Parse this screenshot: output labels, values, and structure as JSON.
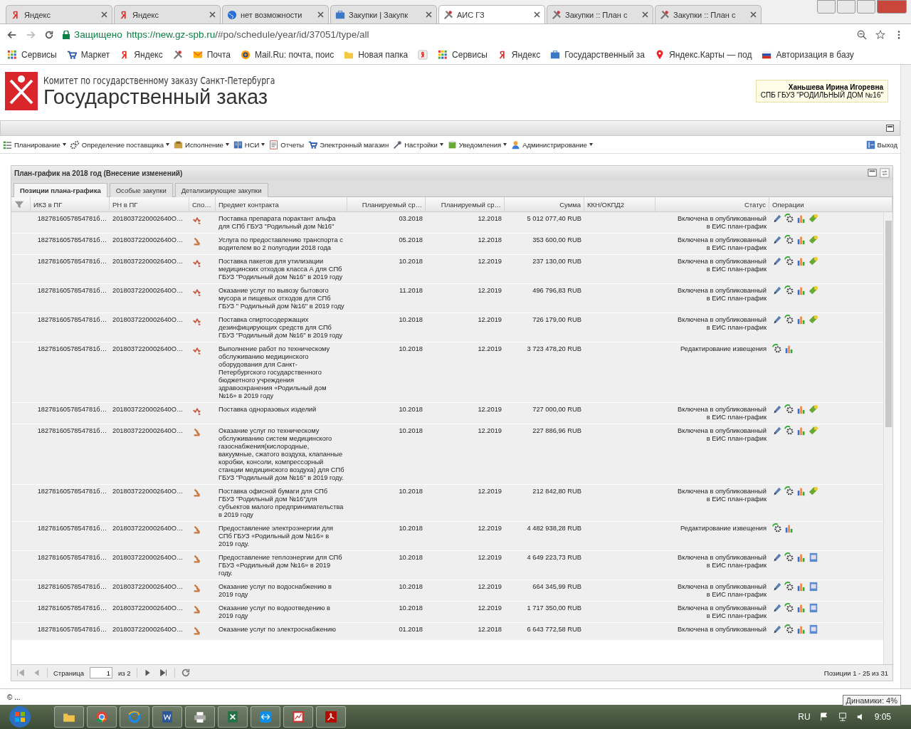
{
  "browser": {
    "tabs": [
      {
        "title": "Яндекс",
        "kind": "yandex",
        "selected": false
      },
      {
        "title": "Яндекс",
        "kind": "yandex",
        "selected": false
      },
      {
        "title": "нет возможности",
        "kind": "globe",
        "selected": false
      },
      {
        "title": "Закупки | Закупк",
        "kind": "case",
        "selected": false
      },
      {
        "title": "АИС ГЗ",
        "kind": "tools",
        "selected": true
      },
      {
        "title": "Закупки :: План с",
        "kind": "tools",
        "selected": false
      },
      {
        "title": "Закупки :: План с",
        "kind": "tools",
        "selected": false
      }
    ],
    "secure_label": "Защищено",
    "url_host": "https://new.gz-spb.ru",
    "url_path": "/#po/schedule/year/id/37051/type/all",
    "bookmarks": [
      {
        "label": "Сервисы",
        "kind": "apps"
      },
      {
        "label": "Маркет",
        "kind": "cart"
      },
      {
        "label": "Яндекс",
        "kind": "yandex"
      },
      {
        "kind": "tools"
      },
      {
        "label": "Почта",
        "kind": "mail"
      },
      {
        "label": "Mail.Ru: почта, поис",
        "kind": "at"
      },
      {
        "label": "Новая папка",
        "kind": "folder"
      },
      {
        "kind": "ya-box"
      },
      {
        "label": "Сервисы",
        "kind": "apps"
      },
      {
        "label": "Яндекс",
        "kind": "yandex"
      },
      {
        "label": "Государственный за",
        "kind": "case"
      },
      {
        "label": "Яндекс.Карты — под",
        "kind": "pin"
      },
      {
        "label": "Авторизация в базу",
        "kind": "flag"
      }
    ]
  },
  "header": {
    "org": "Комитет по государственному заказу Санкт-Петербурга",
    "title": "Государственный заказ",
    "user_name": "Ханьшева Ирина Игоревна",
    "user_org": "СПБ ГБУЗ \"РОДИЛЬНЫЙ ДОМ №16\""
  },
  "menu": [
    {
      "label": "Планирование",
      "kind": "list",
      "caret": true
    },
    {
      "label": "Определение поставщика",
      "kind": "gears",
      "caret": true
    },
    {
      "label": "Исполнение",
      "kind": "box",
      "caret": true
    },
    {
      "label": "НСИ",
      "kind": "book",
      "caret": true
    },
    {
      "label": "Отчеты",
      "kind": "report",
      "caret": false
    },
    {
      "label": "Электронный магазин",
      "kind": "cart",
      "caret": false
    },
    {
      "label": "Настройки",
      "kind": "wrench",
      "caret": true
    },
    {
      "label": "Уведомления",
      "kind": "note",
      "caret": true
    },
    {
      "label": "Администрирование",
      "kind": "person",
      "caret": true
    }
  ],
  "logout": "Выход",
  "panel": {
    "title": "План-график на 2018 год (Внесение изменений)",
    "tabs": [
      {
        "label": "Позиции плана-графика",
        "selected": true
      },
      {
        "label": "Особые закупки",
        "selected": false
      },
      {
        "label": "Детализирующие закупки",
        "selected": false
      }
    ],
    "columns": [
      "ИКЗ в ПГ",
      "РН в ПГ",
      "Спо…",
      "Предмет контракта",
      "Планируемый ср…",
      "Планируемый ср…",
      "Сумма",
      "ККН/ОКПД2",
      "Статус",
      "Операции"
    ],
    "rows": [
      {
        "ikz": "1827816057854781б…",
        "rn": "2018037220002640О…",
        "kind": "tender",
        "subject": "Поставка препарата порактант альфа для СПб ГБУЗ \"Родильный дом №16\"",
        "start": "03.2018",
        "end": "12.2018",
        "sum": "5 012 077,40 RUB",
        "status": "Включена в опубликованный\nв ЕИС план-график",
        "operations": {
          "kind": "full"
        }
      },
      {
        "ikz": "1827816057854781б…",
        "rn": "2018037220002640О…",
        "kind": "auction",
        "subject": "Услуга по предоставлению транспорта с водителем во 2 полугодии 2018 года",
        "start": "05.2018",
        "end": "12.2018",
        "sum": "353 600,00 RUB",
        "status": "Включена в опубликованный\nв ЕИС план-график",
        "operations": {
          "kind": "full"
        }
      },
      {
        "ikz": "1827816057854781б…",
        "rn": "2018037220002640О…",
        "kind": "tender",
        "subject": "Поставка пакетов для утилизации медицинских отходов класса А для СПб ГБУЗ \"Родильный дом №16\" в 2019 году",
        "start": "10.2018",
        "end": "12.2019",
        "sum": "237 130,00 RUB",
        "status": "Включена в опубликованный\nв ЕИС план-график",
        "operations": {
          "kind": "full"
        }
      },
      {
        "ikz": "1827816057854781б…",
        "rn": "2018037220002640О…",
        "kind": "tender",
        "subject": "Оказание услуг по вывозу бытового мусора и пищевых отходов для СПб ГБУЗ \" Родильный дом №16\" в 2019 году",
        "start": "11.2018",
        "end": "12.2019",
        "sum": "496 796,83 RUB",
        "status": "Включена в опубликованный\nв ЕИС план-график",
        "operations": {
          "kind": "full"
        }
      },
      {
        "ikz": "1827816057854781б…",
        "rn": "2018037220002640О…",
        "kind": "tender",
        "subject": "Поставка спиртосодержащих дезинфицирующих средств для СПб ГБУЗ \"Родильный дом №16\" в 2019 году",
        "start": "10.2018",
        "end": "12.2019",
        "sum": "726 179,00 RUB",
        "status": "Включена в опубликованный\nв ЕИС план-график",
        "operations": {
          "kind": "full"
        }
      },
      {
        "ikz": "1827816057854781б…",
        "rn": "2018037220002640О…",
        "kind": "tender",
        "subject": "Выполнение работ по техническому обслуживанию медицинского оборудования для Санкт-Петербургского государственного бюджетного учреждения здравоохранения «Родильный дом №16» в 2019 году",
        "start": "10.2018",
        "end": "12.2019",
        "sum": "3 723 478,20 RUB",
        "status": "Редактирование извещения",
        "operations": {
          "kind": "notice"
        }
      },
      {
        "ikz": "1827816057854781б…",
        "rn": "2018037220002640О…",
        "kind": "tender",
        "subject": "Поставка одноразовых изделий",
        "start": "10.2018",
        "end": "12.2019",
        "sum": "727 000,00 RUB",
        "status": "Включена в опубликованный\nв ЕИС план-график",
        "operations": {
          "kind": "full"
        }
      },
      {
        "ikz": "1827816057854781б…",
        "rn": "2018037220002640О…",
        "kind": "auction",
        "subject": "Оказание услуг по техническому обслуживанию систем медицинского газоснабжения(кислородные, вакуумные, сжатого воздуха, клапанные коробки, консоли, компрессорный станции медицинского воздуха) для СПб ГБУЗ \"Родильный дом №16\" в 2019 году.",
        "start": "10.2018",
        "end": "12.2019",
        "sum": "227 886,96 RUB",
        "status": "Включена в опубликованный\nв ЕИС план-график",
        "operations": {
          "kind": "full"
        }
      },
      {
        "ikz": "1827816057854781б…",
        "rn": "2018037220002640О…",
        "kind": "auction",
        "subject": "Поставка офисной бумаги для СПб ГБУЗ \"Родильный дом №16\"для субъектов малого предпринимательства в 2019 году",
        "start": "10.2018",
        "end": "12.2019",
        "sum": "212 842,80 RUB",
        "status": "Включена в опубликованный\nв ЕИС план-график",
        "operations": {
          "kind": "full"
        }
      },
      {
        "ikz": "1827816057854781б…",
        "rn": "2018037220002640О…",
        "kind": "auction",
        "subject": "Предоставление электроэнергии для СПб ГБУЗ «Родильный дом №16» в 2019 году.",
        "start": "10.2018",
        "end": "12.2019",
        "sum": "4 482 938,28 RUB",
        "status": "Редактирование извещения",
        "operations": {
          "kind": "notice"
        }
      },
      {
        "ikz": "1827816057854781б…",
        "rn": "2018037220002640О…",
        "kind": "auction",
        "subject": "Предоставление теплоэнергии для СПб ГБУЗ «Родильный дом №16» в 2019 году.",
        "start": "10.2018",
        "end": "12.2019",
        "sum": "4 649 223,73 RUB",
        "status": "Включена в опубликованный\nв ЕИС план-график",
        "operations": {
          "kind": "utility"
        }
      },
      {
        "ikz": "1827816057854781б…",
        "rn": "2018037220002640О…",
        "kind": "auction",
        "subject": "Оказание услуг по водоснабжению в 2019 году",
        "start": "10.2018",
        "end": "12.2019",
        "sum": "664 345,99 RUB",
        "status": "Включена в опубликованный\nв ЕИС план-график",
        "operations": {
          "kind": "utility"
        }
      },
      {
        "ikz": "1827816057854781б…",
        "rn": "2018037220002640О…",
        "kind": "auction",
        "subject": "Оказание услуг по водоотведению в 2019 году",
        "start": "10.2018",
        "end": "12.2019",
        "sum": "1 717 350,00 RUB",
        "status": "Включена в опубликованный\nв ЕИС план-график",
        "operations": {
          "kind": "utility"
        }
      },
      {
        "ikz": "1827816057854781б…",
        "rn": "2018037220002640О…",
        "kind": "auction",
        "subject": "Оказание услуг по электроснабжению",
        "start": "01.2018",
        "end": "12.2018",
        "sum": "6 643 772,58 RUB",
        "status": "Включена в опубликованный",
        "operations": {
          "kind": "utility"
        }
      }
    ],
    "pager": {
      "page_label": "Страница",
      "page": "1",
      "of": "из 2",
      "summary": "Позиции 1 - 25 из 31"
    }
  },
  "status_bar": "© ...",
  "taskbar": {
    "apps": [
      {
        "kind": "explorer"
      },
      {
        "kind": "chrome"
      },
      {
        "kind": "ie"
      },
      {
        "kind": "word"
      },
      {
        "kind": "printer"
      },
      {
        "kind": "excel"
      },
      {
        "kind": "teamviewer"
      },
      {
        "kind": "presentation"
      },
      {
        "kind": "pdf"
      }
    ],
    "lang": "RU",
    "time": "9:05",
    "tooltip": "Динамики: 4%"
  }
}
